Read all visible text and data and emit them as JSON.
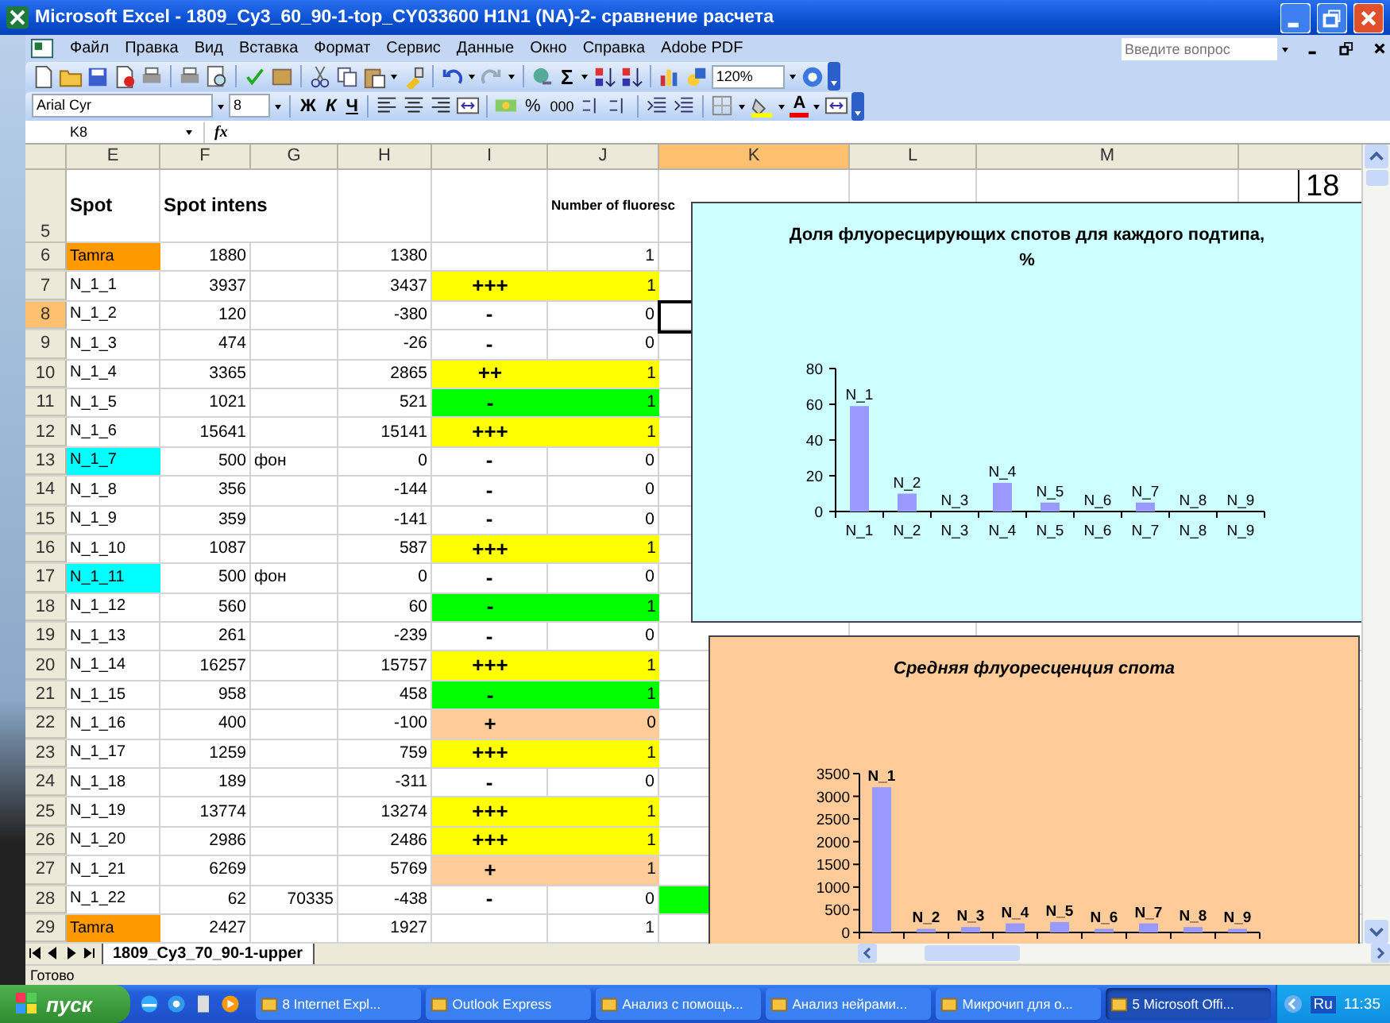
{
  "window": {
    "title": "Microsoft Excel - 1809_Cy3_60_90-1-top_CY033600 H1N1  (NA)-2- сравнение расчета"
  },
  "menu_bar": {
    "items": [
      "Файл",
      "Правка",
      "Вид",
      "Вставка",
      "Формат",
      "Сервис",
      "Данные",
      "Окно",
      "Справка",
      "Adobe PDF"
    ],
    "help_search": {
      "placeholder": "Введите вопрос"
    }
  },
  "standard_toolbar": {
    "autosum": "Σ",
    "zoom": "120%"
  },
  "formatting_toolbar": {
    "font": "Arial Cyr",
    "size": "8",
    "bold": "Ж",
    "italic": "К",
    "underline": "Ч",
    "percent": "%",
    "thousands": "000",
    "font_color": "A"
  },
  "formula_bar": {
    "name_box": "K8",
    "fx": "fx"
  },
  "columns": [
    {
      "label": "E",
      "selected": false
    },
    {
      "label": "F",
      "selected": false
    },
    {
      "label": "G",
      "selected": false
    },
    {
      "label": "H",
      "selected": false
    },
    {
      "label": "I",
      "selected": false
    },
    {
      "label": "J",
      "selected": false
    },
    {
      "label": "K",
      "selected": true
    },
    {
      "label": "L",
      "selected": false
    },
    {
      "label": "M",
      "selected": false
    }
  ],
  "header_row": {
    "number": "5",
    "spot": "Spot",
    "intens": "Spot intens",
    "count": "Number of fluoresc",
    "column_n": "18"
  },
  "rows": [
    {
      "number": "6",
      "spot": {
        "text": "Tamra",
        "color": "#ff9900"
      },
      "intens": "1880",
      "diff": "1380",
      "count": "1",
      "selected": false
    },
    {
      "number": "7",
      "spot": {
        "text": "N_1_1"
      },
      "intens": "3937",
      "diff": "3437",
      "grade": {
        "text": "+++",
        "color": "#ffff00"
      },
      "count": "1",
      "selected": false
    },
    {
      "number": "8",
      "spot": {
        "text": "N_1_2"
      },
      "intens": "120",
      "diff": "-380",
      "grade": {
        "text": "-"
      },
      "count": "0",
      "selected": true
    },
    {
      "number": "9",
      "spot": {
        "text": "N_1_3"
      },
      "intens": "474",
      "diff": "-26",
      "grade": {
        "text": "-"
      },
      "count": "0",
      "selected": false
    },
    {
      "number": "10",
      "spot": {
        "text": "N_1_4"
      },
      "intens": "3365",
      "diff": "2865",
      "grade": {
        "text": "++",
        "color": "#ffff00"
      },
      "count": "1",
      "selected": false
    },
    {
      "number": "11",
      "spot": {
        "text": "N_1_5"
      },
      "intens": "1021",
      "diff": "521",
      "grade": {
        "text": "-",
        "color": "#00ff00"
      },
      "count": "1",
      "selected": false
    },
    {
      "number": "12",
      "spot": {
        "text": "N_1_6"
      },
      "intens": "15641",
      "diff": "15141",
      "grade": {
        "text": "+++",
        "color": "#ffff00"
      },
      "count": "1",
      "selected": false
    },
    {
      "number": "13",
      "spot": {
        "text": "N_1_7",
        "color": "#00ffff"
      },
      "intens": "500",
      "note": "фон",
      "diff": "0",
      "grade": {
        "text": "-"
      },
      "count": "0",
      "selected": false
    },
    {
      "number": "14",
      "spot": {
        "text": "N_1_8"
      },
      "intens": "356",
      "diff": "-144",
      "grade": {
        "text": "-"
      },
      "count": "0",
      "selected": false
    },
    {
      "number": "15",
      "spot": {
        "text": "N_1_9"
      },
      "intens": "359",
      "diff": "-141",
      "grade": {
        "text": "-"
      },
      "count": "0",
      "selected": false
    },
    {
      "number": "16",
      "spot": {
        "text": "N_1_10"
      },
      "intens": "1087",
      "diff": "587",
      "grade": {
        "text": "+++",
        "color": "#ffff00"
      },
      "count": "1",
      "selected": false
    },
    {
      "number": "17",
      "spot": {
        "text": "N_1_11",
        "color": "#00ffff"
      },
      "intens": "500",
      "note": "фон",
      "diff": "0",
      "grade": {
        "text": "-"
      },
      "count": "0",
      "selected": false
    },
    {
      "number": "18",
      "spot": {
        "text": "N_1_12"
      },
      "intens": "560",
      "diff": "60",
      "grade": {
        "text": "-",
        "color": "#00ff00"
      },
      "count": "1",
      "selected": false
    },
    {
      "number": "19",
      "spot": {
        "text": "N_1_13"
      },
      "intens": "261",
      "diff": "-239",
      "grade": {
        "text": "-"
      },
      "count": "0",
      "selected": false
    },
    {
      "number": "20",
      "spot": {
        "text": "N_1_14"
      },
      "intens": "16257",
      "diff": "15757",
      "grade": {
        "text": "+++",
        "color": "#ffff00"
      },
      "count": "1",
      "selected": false
    },
    {
      "number": "21",
      "spot": {
        "text": "N_1_15"
      },
      "intens": "958",
      "diff": "458",
      "grade": {
        "text": "-",
        "color": "#00ff00"
      },
      "count": "1",
      "selected": false
    },
    {
      "number": "22",
      "spot": {
        "text": "N_1_16"
      },
      "intens": "400",
      "diff": "-100",
      "grade": {
        "text": "+",
        "color": "#ffcc99"
      },
      "count": "0",
      "selected": false
    },
    {
      "number": "23",
      "spot": {
        "text": "N_1_17"
      },
      "intens": "1259",
      "diff": "759",
      "grade": {
        "text": "+++",
        "color": "#ffff00"
      },
      "count": "1",
      "selected": false
    },
    {
      "number": "24",
      "spot": {
        "text": "N_1_18"
      },
      "intens": "189",
      "diff": "-311",
      "grade": {
        "text": "-"
      },
      "count": "0",
      "selected": false
    },
    {
      "number": "25",
      "spot": {
        "text": "N_1_19"
      },
      "intens": "13774",
      "diff": "13274",
      "grade": {
        "text": "+++",
        "color": "#ffff00"
      },
      "count": "1",
      "selected": false
    },
    {
      "number": "26",
      "spot": {
        "text": "N_1_20"
      },
      "intens": "2986",
      "diff": "2486",
      "grade": {
        "text": "+++",
        "color": "#ffff00"
      },
      "count": "1",
      "selected": false
    },
    {
      "number": "27",
      "spot": {
        "text": "N_1_21"
      },
      "intens": "6269",
      "diff": "5769",
      "grade": {
        "text": "+",
        "color": "#ffcc99"
      },
      "count": "1",
      "selected": false
    },
    {
      "number": "28",
      "spot": {
        "text": "N_1_22"
      },
      "intens": "62",
      "note": "70335",
      "diff": "-438",
      "grade": {
        "text": "-"
      },
      "count": "0",
      "k_cell": {
        "color": "#00ff00"
      },
      "selected": false
    },
    {
      "number": "29",
      "spot": {
        "text": "Tamra",
        "color": "#ff9900"
      },
      "intens": "2427",
      "diff": "1927",
      "count": "1",
      "selected": false
    }
  ],
  "charts": [
    {
      "chart_data": {
        "type": "bar",
        "title": "Доля флуоресцирующих спотов для каждого подтипа, %",
        "categories": [
          "N_1",
          "N_2",
          "N_3",
          "N_4",
          "N_5",
          "N_6",
          "N_7",
          "N_8",
          "N_9"
        ],
        "values": [
          59,
          10,
          0,
          16,
          5,
          0,
          5,
          0,
          0
        ],
        "ylim": [
          0,
          80
        ],
        "yticks": [
          0,
          20,
          40,
          60,
          80
        ],
        "annotations": [
          "N_1",
          "N_2",
          "N_3",
          "N_4",
          "N_5",
          "N_6",
          "N_7",
          "N_8",
          "N_9"
        ]
      }
    },
    {
      "chart_data": {
        "type": "bar",
        "title": "Средняя флуоресценция спота",
        "categories": [
          "N_1",
          "N_2",
          "N_3",
          "N_4",
          "N_5",
          "N_6",
          "N_7",
          "N_8",
          "N_9"
        ],
        "values": [
          3200,
          80,
          120,
          200,
          230,
          80,
          200,
          120,
          80
        ],
        "ylim": [
          0,
          3500
        ],
        "yticks": [
          0,
          500,
          1000,
          1500,
          2000,
          2500,
          3000,
          3500
        ]
      }
    }
  ],
  "sheet_tabs": [
    {
      "label": "1809_Cy3_70_90-1-upper",
      "selected": true
    }
  ],
  "status_bar": {
    "text": "Готово"
  },
  "taskbar": {
    "start": "пуск",
    "tasks": [
      {
        "label": "8 Internet Expl...",
        "selected": false
      },
      {
        "label": "Outlook Express",
        "selected": false
      },
      {
        "label": "Анализ с помощь...",
        "selected": false
      },
      {
        "label": "Анализ нейрами...",
        "selected": false
      },
      {
        "label": "Микрочип для о...",
        "selected": false
      },
      {
        "label": "5 Microsoft Offi...",
        "selected": true
      }
    ],
    "language": "Ru",
    "clock": "11:35"
  }
}
